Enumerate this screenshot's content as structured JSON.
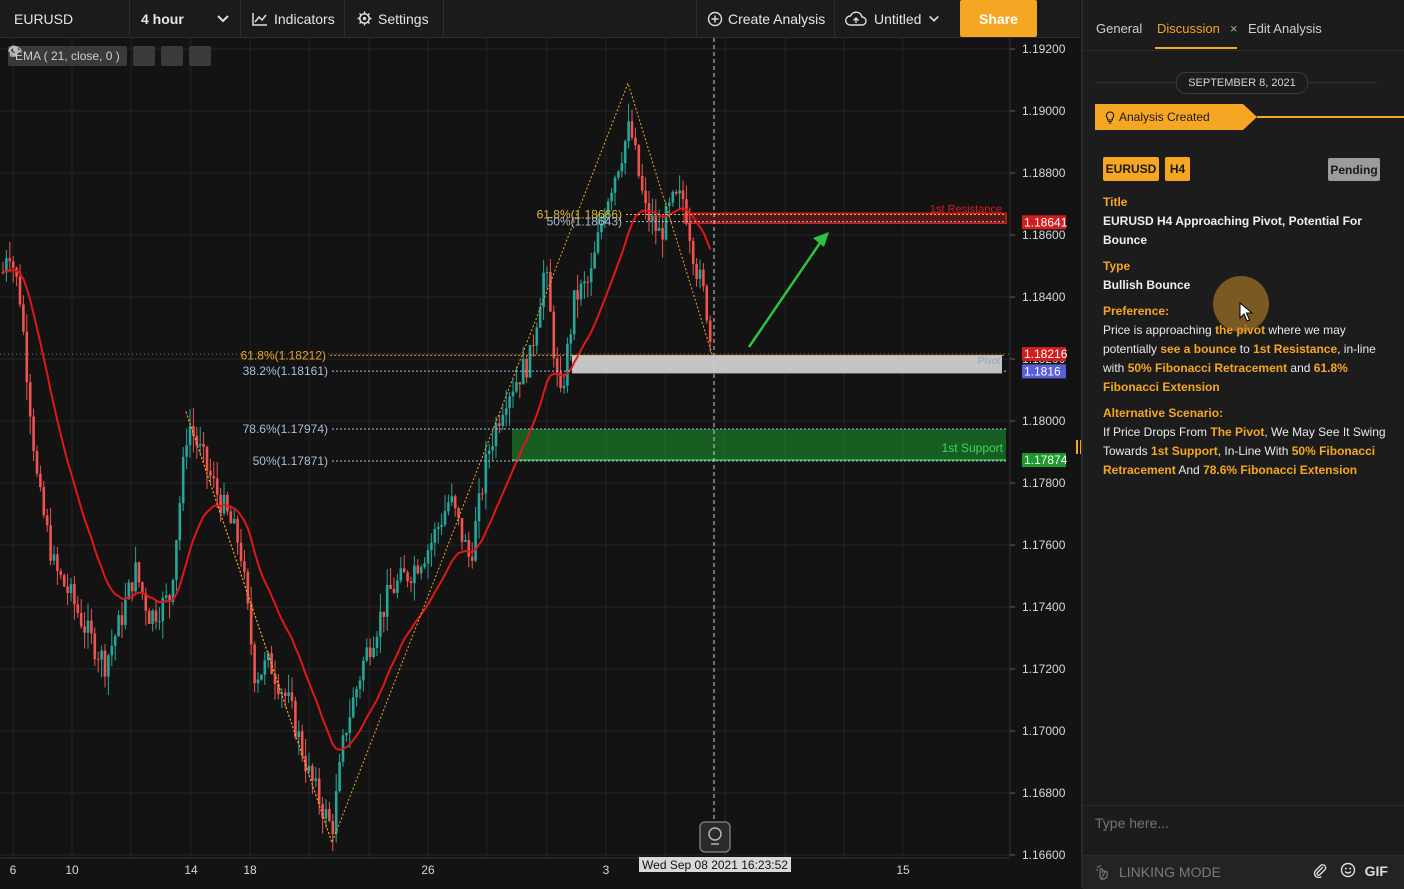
{
  "toolbar": {
    "symbol": "EURUSD",
    "interval": "4 hour",
    "indicators_label": "Indicators",
    "settings_label": "Settings",
    "create_label": "Create Analysis",
    "untitled_label": "Untitled",
    "share_label": "Share"
  },
  "indicator_chip": {
    "label": "EMA ( 21, close, 0 )"
  },
  "chart": {
    "price_axis": [
      "1.19200",
      "1.19000",
      "1.18800",
      "1.18600",
      "1.18400",
      "1.18200",
      "1.18000",
      "1.17800",
      "1.17600",
      "1.17400",
      "1.17200",
      "1.17000",
      "1.16800",
      "1.16600"
    ],
    "time_axis": [
      "6",
      "10",
      "14",
      "18",
      "26",
      "3",
      "15"
    ],
    "crosshair_time": "Wed Sep 08 2021 16:23:52",
    "price_tags": {
      "resistance": "1.18641",
      "last": "1.18216",
      "pivot": "1.1816",
      "support": "1.17874"
    },
    "fib_labels": {
      "upper_618": "61.8%(1.18666)",
      "upper_50": "50%(1.18643)",
      "lower_618": "61.8%(1.18212)",
      "lower_382": "38.2%(1.18161)",
      "lower_786": "78.6%(1.17974)",
      "lower_50": "50%(1.17871)"
    },
    "zone_labels": {
      "resistance": "1st Resistance",
      "support": "1st Support",
      "pivot": "Pivot"
    },
    "colors": {
      "up": "#26a69a",
      "down": "#ef5350",
      "ema": "#e0171a",
      "support": "#1e9a2e",
      "resistance": "#d21e1e",
      "pivot": "#cfcfcf",
      "accent": "#f5a623"
    }
  },
  "panel": {
    "tabs": {
      "general": "General",
      "discussion": "Discussion",
      "close": "×",
      "edit": "Edit Analysis"
    },
    "date": "SEPTEMBER 8, 2021",
    "created": "Analysis Created",
    "badges": {
      "pair": "EURUSD",
      "timeframe": "H4",
      "status": "Pending"
    },
    "title_key": "Title",
    "title_val": "EURUSD H4 Approaching Pivot, Potential For Bounce",
    "type_key": "Type",
    "type_val": "Bullish Bounce",
    "pref_key": "Preference:",
    "pref": {
      "t1": "Price is approaching ",
      "h1": "the pivot",
      "t2": " where we may potentially ",
      "h2": "see a bounce",
      "t3": " to ",
      "h3": "1st Resistance",
      "t4": ", in-line with ",
      "h4": "50% Fibonacci Retracement",
      "t5": " and ",
      "h5": "61.8% Fibonacci Extension"
    },
    "alt_key": "Alternative Scenario:",
    "alt": {
      "t1": "If Price Drops From ",
      "h1": "The Pivot",
      "t2": ", We May See It Swing Towards ",
      "h2": "1st Support",
      "t3": ", In-Line With ",
      "h3": "50% Fibonacci Retracement",
      "t4": " And ",
      "h4": "78.6% Fibonacci Extension"
    },
    "compose_placeholder": "Type here...",
    "linking_mode": "LINKING MODE",
    "gif": "GIF"
  }
}
